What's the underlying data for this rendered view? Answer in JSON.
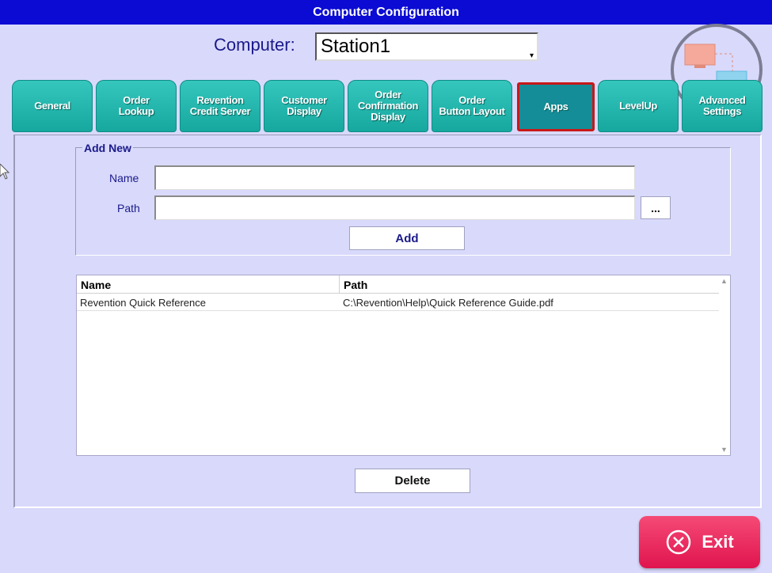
{
  "window": {
    "title": "Computer Configuration"
  },
  "computer": {
    "label": "Computer:",
    "selected": "Station1"
  },
  "tabs": [
    {
      "label": "General",
      "active": false
    },
    {
      "label": "Order\nLookup",
      "active": false
    },
    {
      "label": "Revention\nCredit Server",
      "active": false
    },
    {
      "label": "Customer\nDisplay",
      "active": false
    },
    {
      "label": "Order\nConfirmation\nDisplay",
      "active": false
    },
    {
      "label": "Order\nButton Layout",
      "active": false
    },
    {
      "label": "Apps",
      "active": true
    },
    {
      "label": "LevelUp",
      "active": false
    },
    {
      "label": "Advanced\nSettings",
      "active": false
    }
  ],
  "add_new": {
    "title": "Add New",
    "name_label": "Name",
    "name_value": "",
    "path_label": "Path",
    "path_value": "",
    "browse_label": "...",
    "add_label": "Add"
  },
  "apps_list": {
    "columns": [
      "Name",
      "Path"
    ],
    "rows": [
      {
        "name": "Revention Quick Reference",
        "path": "C:\\Revention\\Help\\Quick Reference Guide.pdf"
      }
    ]
  },
  "delete_label": "Delete",
  "exit_label": "Exit",
  "colors": {
    "title_bar": "#0b0bd4",
    "background": "#d9d9fb",
    "tab": "#22b8ae",
    "tab_active": "#148d98",
    "active_border": "#c81818",
    "exit": "#e91e55"
  }
}
